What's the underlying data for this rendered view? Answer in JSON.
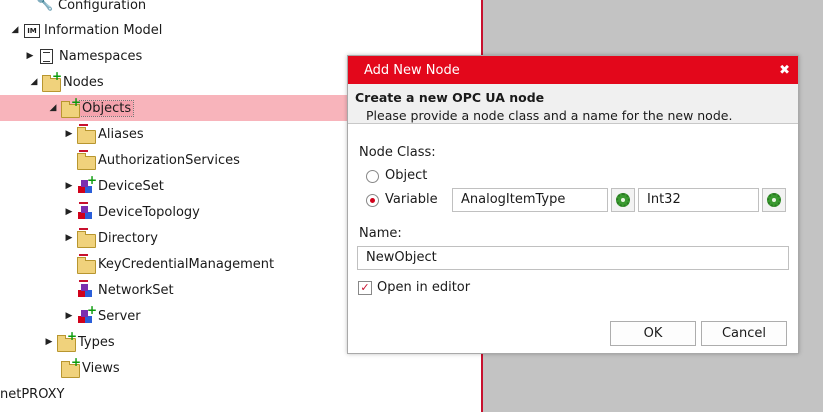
{
  "tree": {
    "items": [
      {
        "label": "Configuration",
        "icon": "wrench-icon"
      },
      {
        "label": "Information Model",
        "icon": "information-model-icon",
        "icon_text": "IM"
      },
      {
        "label": "Namespaces",
        "icon": "namespaces-icon"
      },
      {
        "label": "Nodes",
        "icon": "folder-add-icon"
      },
      {
        "label": "Objects",
        "icon": "folder-add-icon",
        "selected": true
      },
      {
        "label": "Aliases",
        "icon": "folder-remove-icon"
      },
      {
        "label": "AuthorizationServices",
        "icon": "folder-remove-icon"
      },
      {
        "label": "DeviceSet",
        "icon": "objects-add-icon"
      },
      {
        "label": "DeviceTopology",
        "icon": "objects-remove-icon"
      },
      {
        "label": "Directory",
        "icon": "folder-remove-icon"
      },
      {
        "label": "KeyCredentialManagement",
        "icon": "folder-remove-icon"
      },
      {
        "label": "NetworkSet",
        "icon": "objects-remove-icon"
      },
      {
        "label": "Server",
        "icon": "objects-add-icon"
      },
      {
        "label": "Types",
        "icon": "folder-add-icon"
      },
      {
        "label": "Views",
        "icon": "folder-add-icon"
      },
      {
        "label": "netPROXY",
        "icon": ""
      }
    ]
  },
  "dialog": {
    "title": "Add New Node",
    "close_glyph": "✖",
    "header_title": "Create a new OPC UA node",
    "header_subtitle": "Please provide a node class and a name for the new node.",
    "node_class_label": "Node Class:",
    "options": [
      {
        "label": "Object",
        "selected": false
      },
      {
        "label": "Variable",
        "selected": true
      }
    ],
    "type_value": "AnalogItemType",
    "datatype_value": "Int32",
    "name_label": "Name:",
    "name_value": "NewObject",
    "open_in_editor_label": "Open in editor",
    "open_in_editor_checked": true,
    "checkmark": "✓",
    "ok_label": "OK",
    "cancel_label": "Cancel"
  },
  "colors": {
    "accent": "#e3071b",
    "selection": "#f8b4bb",
    "background": "#c3c3c3"
  }
}
